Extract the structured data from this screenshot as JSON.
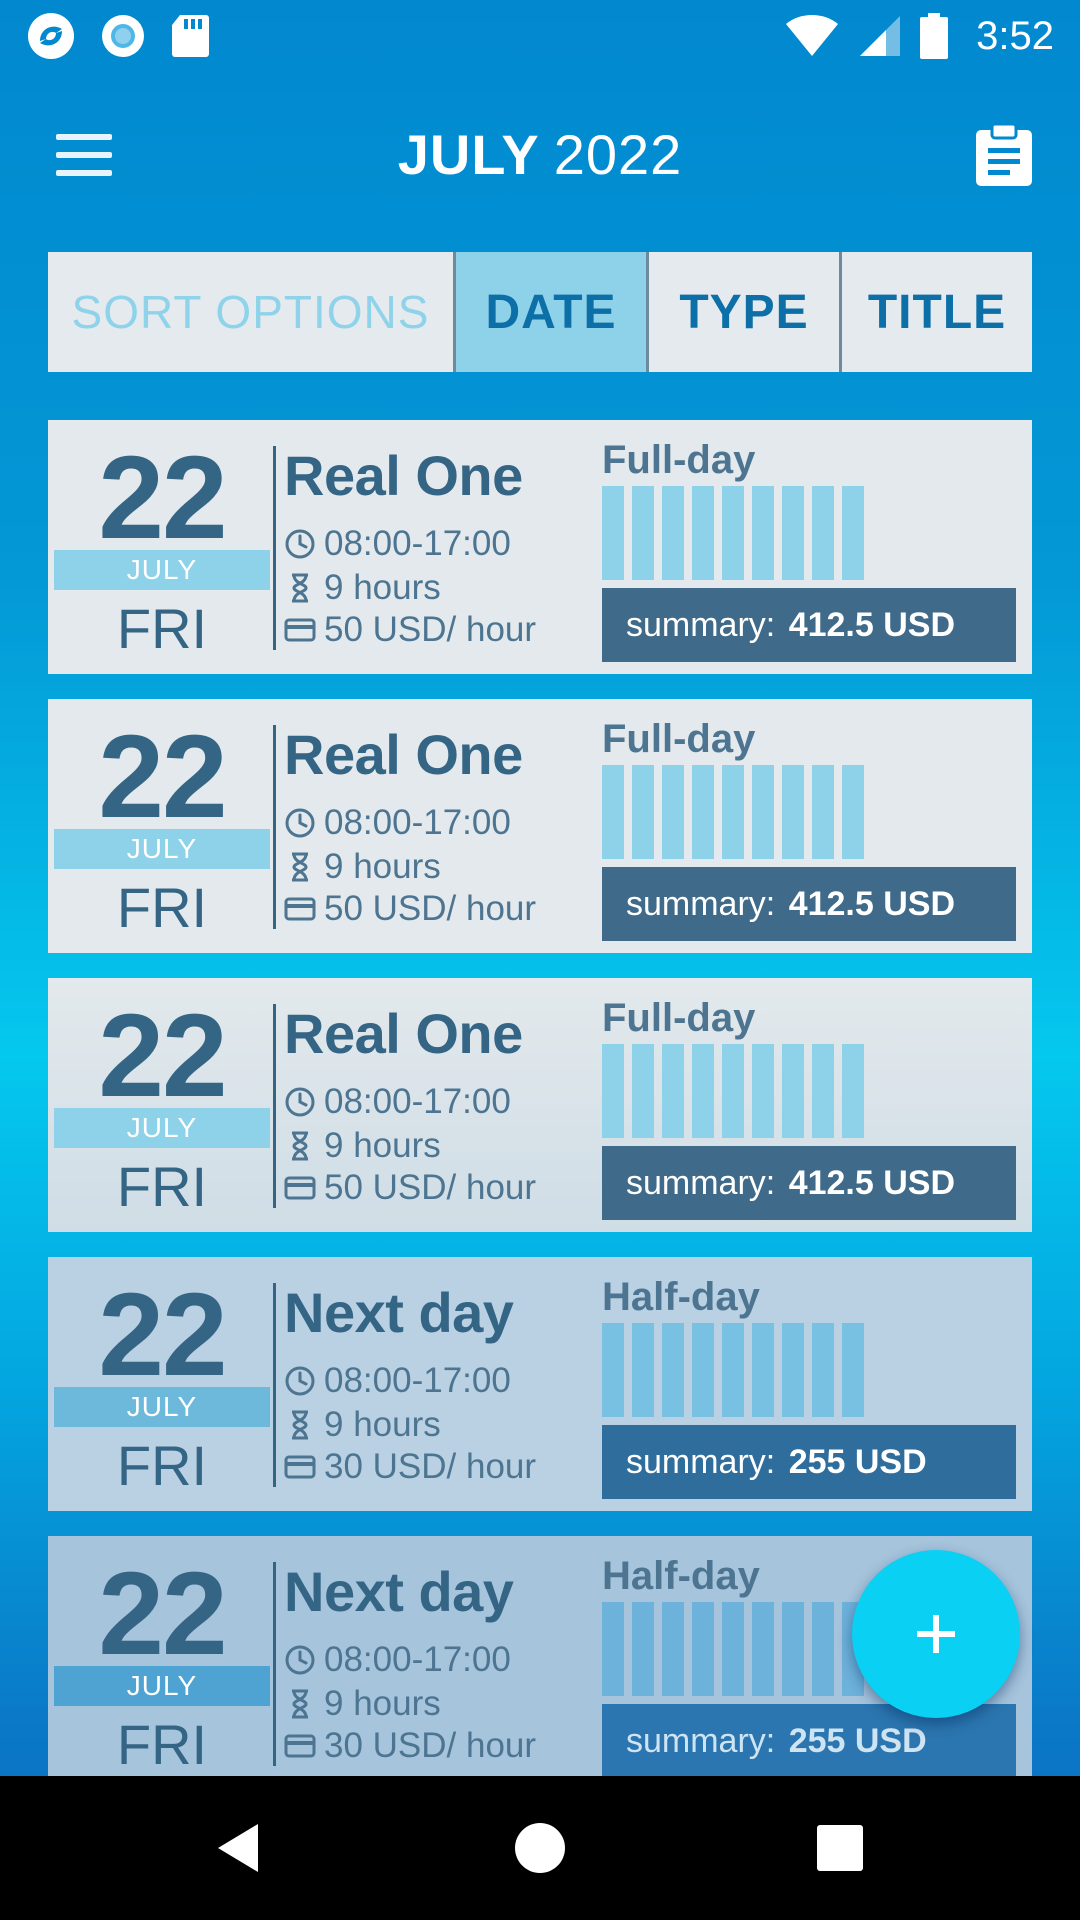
{
  "status_bar": {
    "time": "3:52",
    "left_icons": [
      "app-logo-icon",
      "record-icon",
      "sd-card-icon"
    ],
    "right_icons": [
      "wifi-icon",
      "signal-icon",
      "battery-icon"
    ]
  },
  "app_bar": {
    "month": "JULY",
    "year": "2022",
    "menu_icon": "hamburger-menu-icon",
    "action_icon": "clipboard-icon"
  },
  "sort_bar": {
    "label": "SORT OPTIONS",
    "tabs": [
      {
        "label": "DATE",
        "active": true
      },
      {
        "label": "TYPE",
        "active": false
      },
      {
        "label": "TITLE",
        "active": false
      }
    ]
  },
  "entries": [
    {
      "day": "22",
      "month": "JULY",
      "weekday": "FRI",
      "title": "Real One",
      "time": "08:00-17:00",
      "hours": "9 hours",
      "rate": "50 USD/ hour",
      "type": "Full-day",
      "summary_label": "summary:",
      "summary_value": "412.5 USD"
    },
    {
      "day": "22",
      "month": "JULY",
      "weekday": "FRI",
      "title": "Real One",
      "time": "08:00-17:00",
      "hours": "9 hours",
      "rate": "50 USD/ hour",
      "type": "Full-day",
      "summary_label": "summary:",
      "summary_value": "412.5 USD"
    },
    {
      "day": "22",
      "month": "JULY",
      "weekday": "FRI",
      "title": "Real One",
      "time": "08:00-17:00",
      "hours": "9 hours",
      "rate": "50 USD/ hour",
      "type": "Full-day",
      "summary_label": "summary:",
      "summary_value": "412.5 USD"
    },
    {
      "day": "22",
      "month": "JULY",
      "weekday": "FRI",
      "title": "Next day",
      "time": "08:00-17:00",
      "hours": "9 hours",
      "rate": "30 USD/ hour",
      "type": "Half-day",
      "summary_label": "summary:",
      "summary_value": "255 USD"
    },
    {
      "day": "22",
      "month": "JULY",
      "weekday": "FRI",
      "title": "Next day",
      "time": "08:00-17:00",
      "hours": "9 hours",
      "rate": "30 USD/ hour",
      "type": "Half-day",
      "summary_label": "summary:",
      "summary_value": "255 USD"
    }
  ],
  "fab": {
    "icon": "plus-icon"
  },
  "nav_bar": {
    "icons": [
      "back-icon",
      "home-icon",
      "recents-icon"
    ]
  },
  "colors": {
    "primary_dark": "#356585",
    "accent_light": "#8ed2ea",
    "summary_bg": "#3f6a89",
    "fab": "#0ad0f4"
  }
}
